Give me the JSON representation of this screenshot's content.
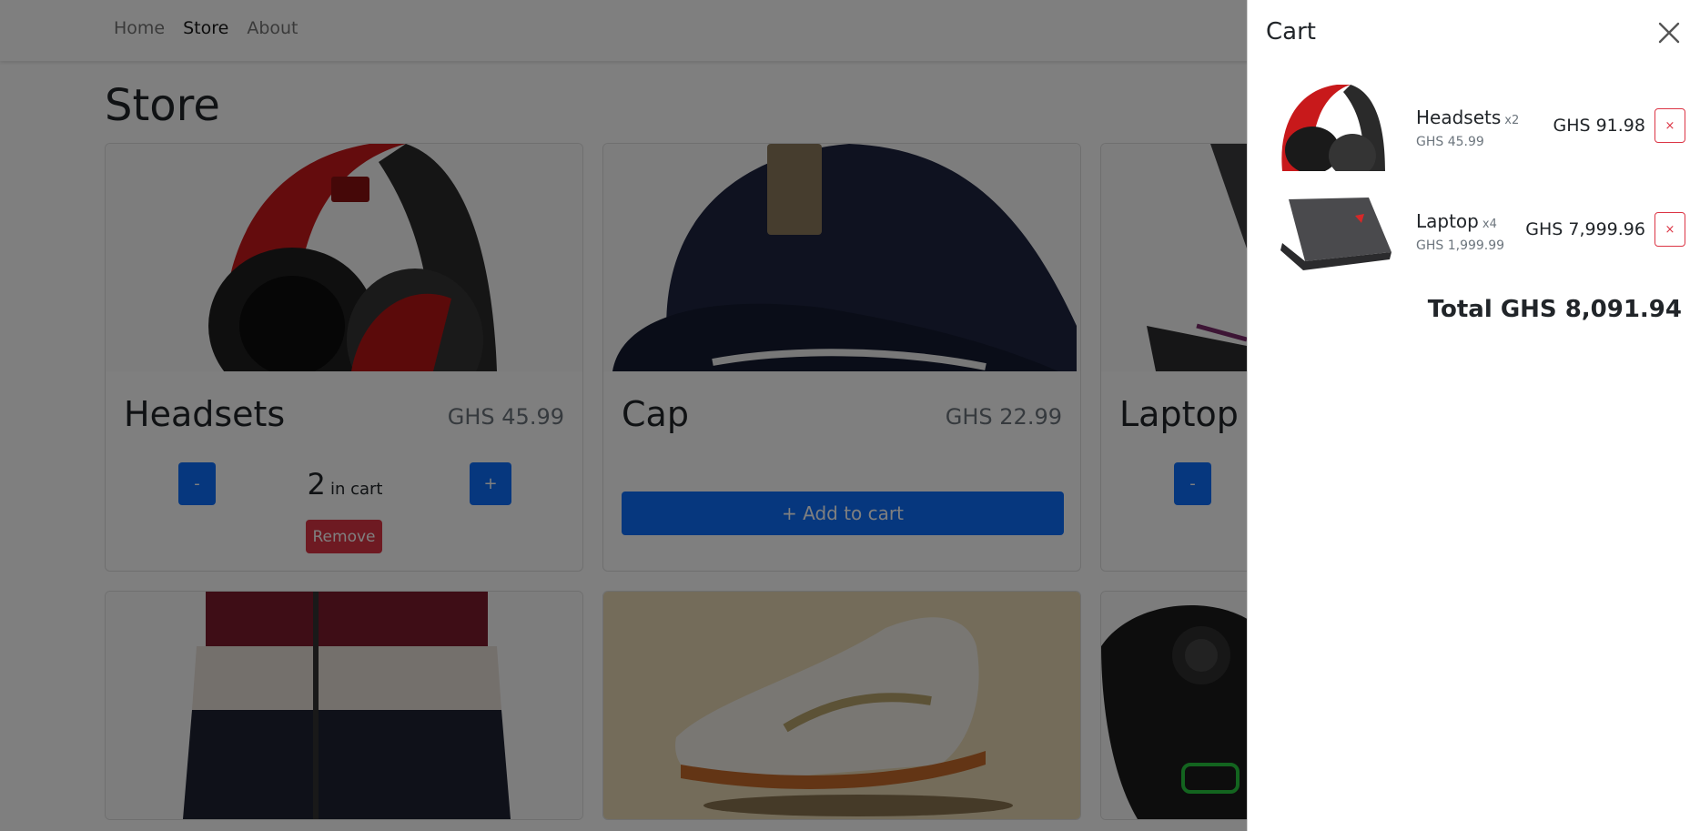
{
  "nav": {
    "home": "Home",
    "store": "Store",
    "about": "About"
  },
  "page": {
    "title": "Store"
  },
  "products": [
    {
      "name": "Headsets",
      "price": "GHS 45.99",
      "qty": "2",
      "in_cart_label": "in cart",
      "minus": "-",
      "plus": "+",
      "remove": "Remove",
      "image": "headset-image"
    },
    {
      "name": "Cap",
      "price": "GHS 22.99",
      "add": "+ Add to cart",
      "image": "cap-image"
    },
    {
      "name": "Laptop",
      "minus": "-",
      "image": "laptop-image"
    },
    {
      "image": "jacket-image"
    },
    {
      "image": "sneaker-image"
    },
    {
      "image": "gamepad-image"
    }
  ],
  "cart": {
    "title": "Cart",
    "close_icon": "close-icon",
    "items": [
      {
        "name": "Headsets",
        "qty": "x2",
        "unit_price": "GHS 45.99",
        "line_total": "GHS 91.98",
        "remove": "×"
      },
      {
        "name": "Laptop",
        "qty": "x4",
        "unit_price": "GHS 1,999.99",
        "line_total": "GHS 7,999.96",
        "remove": "×"
      }
    ],
    "total": "Total GHS 8,091.94"
  },
  "colors": {
    "primary": "#0d6efd",
    "danger": "#dc3545",
    "overlay": "rgba(0,0,0,0.5)"
  }
}
